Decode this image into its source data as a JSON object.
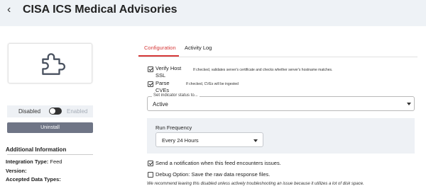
{
  "header": {
    "title": "CISA ICS Medical Advisories",
    "back_icon": "chevron-left-icon"
  },
  "sidebar": {
    "plugin_icon": "puzzle-piece-icon",
    "toggle": {
      "disabled_label": "Disabled",
      "enabled_label": "Enabled",
      "state": "disabled"
    },
    "uninstall_label": "Uninstall",
    "info": {
      "title": "Additional Information",
      "integration_type_label": "Integration Type:",
      "integration_type_value": "Feed",
      "version_label": "Version:",
      "accepted_types_label": "Accepted Data Types:"
    }
  },
  "tabs": [
    {
      "label": "Configuration",
      "active": true
    },
    {
      "label": "Activity Log",
      "active": false
    }
  ],
  "settings": {
    "verify_host": {
      "label_line1": "Verify Host",
      "label_line2": "SSL",
      "checked": true,
      "hint": "If checked, validates server's certificate and checks whether server's hostname matches."
    },
    "parse_cves": {
      "label_line1": "Parse",
      "label_line2": "CVEs",
      "checked": true,
      "hint": "If checked, CVEs will be ingested"
    },
    "indicator_status": {
      "legend": "Set indicator status to...",
      "value": "Active"
    },
    "run_frequency": {
      "label": "Run Frequency",
      "value": "Every 24 Hours"
    },
    "notify": {
      "label": "Send a notification when this feed encounters issues.",
      "checked": true
    },
    "debug": {
      "label": "Debug Option: Save the raw data response files.",
      "checked": false
    },
    "debug_note": "We recommend leaving this disabled unless actively troubleshooting an issue because it utilizes a lot of disk space."
  },
  "colors": {
    "accent": "#d63a3a",
    "header_bg": "#eef2f6",
    "button_bg": "#6f7586"
  }
}
